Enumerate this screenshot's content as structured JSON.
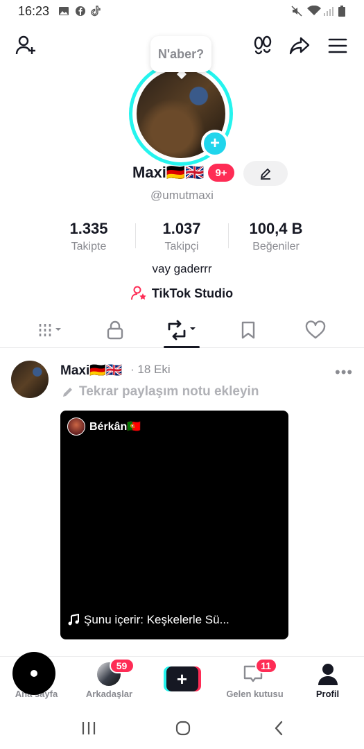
{
  "status_bar": {
    "time": "16:23"
  },
  "profile": {
    "note_bubble": "N'aber?",
    "display_name": "Maxi🇩🇪🇬🇧",
    "notifications_badge": "9+",
    "username": "@umutmaxi",
    "stats": [
      {
        "value": "1.335",
        "label": "Takipte"
      },
      {
        "value": "1.037",
        "label": "Takipçi"
      },
      {
        "value": "100,4 B",
        "label": "Beğeniler"
      }
    ],
    "bio": "vay gaderrr",
    "studio_link": "TikTok Studio"
  },
  "tabs": [
    {
      "icon": "grid-icon",
      "active": false
    },
    {
      "icon": "lock-icon",
      "active": false
    },
    {
      "icon": "repost-icon",
      "active": true
    },
    {
      "icon": "bookmark-icon",
      "active": false
    },
    {
      "icon": "heart-icon",
      "active": false
    }
  ],
  "post": {
    "author": "Maxi🇩🇪🇬🇧",
    "date": "· 18 Eki",
    "note_placeholder": "Tekrar paylaşım notu ekleyin",
    "video_author": "Bérkân🇵🇹",
    "music": "Şunu içerir: Keşkelerle Sü..."
  },
  "bottom_nav": {
    "home": "Ana sayfa",
    "friends": "Arkadaşlar",
    "friends_badge": "59",
    "inbox": "Gelen kutusu",
    "inbox_badge": "11",
    "profile": "Profil"
  },
  "colors": {
    "accent": "#FE2C55",
    "cyan": "#25F4EE",
    "text": "#161823",
    "muted": "#8a8b91"
  }
}
